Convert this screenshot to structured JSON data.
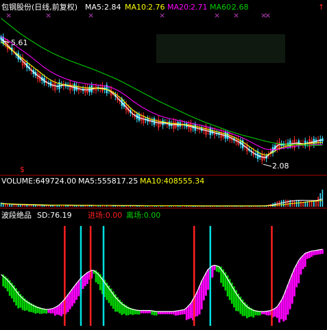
{
  "colors": {
    "bg": "#000000",
    "white": "#FFFFFF",
    "yellow": "#FFFF00",
    "magenta": "#FF00FF",
    "green": "#00D000",
    "red": "#FF2020",
    "cyan": "#00E0E0",
    "candle_up": "#FF3030",
    "candle_down": "#40E0FF",
    "separator": "#B00000",
    "cross": "#C040C0",
    "watermark": "#1A2A1A"
  },
  "price_panel": {
    "title": "包钢股份(日线,前复权)",
    "ma5_label": "MA5:",
    "ma5_value": "2.84",
    "ma10_label": "MA10:",
    "ma10_value": "2.76",
    "ma20_label": "MA20:",
    "ma20_value": "2.71",
    "ma60_label": "MA60:",
    "ma60_value": "2.68",
    "high_marker": "5.61",
    "low_marker": "2.08",
    "currency_icon": "$"
  },
  "volume_panel": {
    "label": "VOLUME:649724.00",
    "ma5_label": "MA5:555817.25",
    "ma10_label": "MA10:408555.34"
  },
  "indicator_panel": {
    "name": "波段绝品",
    "sd_label": "SD:76.19",
    "entry_label": "进场:0.00",
    "exit_label": "离场:0.00"
  },
  "chart_data": [
    {
      "type": "line",
      "panel": "price",
      "ylim": [
        1.9,
        6.6
      ],
      "x_count": 150,
      "high_marker_value": 5.61,
      "low_marker_value": 2.08,
      "series": [
        {
          "name": "MA5",
          "color": "#FFFFFF",
          "values": [
            5.9,
            5.7,
            5.5,
            5.3,
            5.1,
            4.9,
            4.75,
            4.6,
            4.5,
            4.45,
            4.5,
            4.45,
            4.4,
            4.35,
            4.35,
            4.4,
            4.4,
            4.35,
            4.2,
            4.0,
            3.8,
            3.6,
            3.5,
            3.45,
            3.4,
            3.35,
            3.35,
            3.3,
            3.3,
            3.3,
            3.25,
            3.2,
            3.15,
            3.1,
            3.05,
            3.0,
            2.95,
            2.85,
            2.75,
            2.6,
            2.45,
            2.35,
            2.3,
            2.5,
            2.7,
            2.7,
            2.72,
            2.75,
            2.72,
            2.76,
            2.8,
            2.84
          ]
        },
        {
          "name": "MA10",
          "color": "#FFFF00",
          "values": [
            5.8,
            5.65,
            5.5,
            5.35,
            5.2,
            5.05,
            4.9,
            4.75,
            4.62,
            4.55,
            4.5,
            4.48,
            4.45,
            4.42,
            4.4,
            4.4,
            4.38,
            4.35,
            4.25,
            4.1,
            3.9,
            3.72,
            3.6,
            3.52,
            3.45,
            3.4,
            3.37,
            3.34,
            3.32,
            3.3,
            3.28,
            3.24,
            3.2,
            3.15,
            3.1,
            3.05,
            3.0,
            2.92,
            2.82,
            2.7,
            2.56,
            2.44,
            2.38,
            2.45,
            2.58,
            2.64,
            2.68,
            2.71,
            2.72,
            2.74,
            2.75,
            2.76
          ]
        },
        {
          "name": "MA20",
          "color": "#FF00FF",
          "values": [
            5.95,
            5.85,
            5.72,
            5.58,
            5.45,
            5.3,
            5.15,
            5.0,
            4.88,
            4.78,
            4.7,
            4.63,
            4.58,
            4.55,
            4.52,
            4.5,
            4.48,
            4.45,
            4.38,
            4.28,
            4.15,
            4.0,
            3.87,
            3.76,
            3.66,
            3.58,
            3.52,
            3.47,
            3.43,
            3.39,
            3.35,
            3.31,
            3.27,
            3.22,
            3.17,
            3.12,
            3.07,
            3.0,
            2.93,
            2.84,
            2.74,
            2.64,
            2.56,
            2.54,
            2.56,
            2.6,
            2.63,
            2.66,
            2.68,
            2.69,
            2.7,
            2.71
          ]
        },
        {
          "name": "MA60",
          "color": "#00D000",
          "values": [
            6.5,
            6.35,
            6.2,
            6.05,
            5.92,
            5.8,
            5.68,
            5.57,
            5.47,
            5.38,
            5.3,
            5.22,
            5.15,
            5.08,
            5.01,
            4.94,
            4.86,
            4.78,
            4.7,
            4.61,
            4.51,
            4.41,
            4.31,
            4.21,
            4.11,
            4.01,
            3.92,
            3.83,
            3.74,
            3.65,
            3.56,
            3.48,
            3.4,
            3.33,
            3.26,
            3.19,
            3.12,
            3.06,
            3.0,
            2.95,
            2.9,
            2.85,
            2.8,
            2.76,
            2.73,
            2.71,
            2.7,
            2.69,
            2.685,
            2.68,
            2.68,
            2.68
          ]
        }
      ]
    },
    {
      "type": "bar",
      "panel": "volume",
      "ylim": [
        0,
        1.2
      ],
      "x_count": 150,
      "series": [
        {
          "name": "VOLUME",
          "values": [
            0.25,
            0.18,
            0.12,
            0.1,
            0.14,
            0.1,
            0.08,
            0.08,
            0.1,
            0.12,
            0.1,
            0.08,
            0.07,
            0.06,
            0.08,
            0.1,
            0.09,
            0.07,
            0.06,
            0.06,
            0.07,
            0.08,
            0.06,
            0.05,
            0.06,
            0.07,
            0.06,
            0.05,
            0.05,
            0.06,
            0.05,
            0.05,
            0.06,
            0.05,
            0.05,
            0.06,
            0.06,
            0.05,
            0.05,
            0.06,
            0.05,
            0.05,
            0.08,
            0.18,
            0.35,
            0.42,
            0.4,
            0.38,
            0.3,
            0.35,
            0.4,
            1.0
          ]
        },
        {
          "name": "MA5",
          "values": [
            0.2,
            0.17,
            0.14,
            0.13,
            0.12,
            0.11,
            0.1,
            0.09,
            0.09,
            0.1,
            0.1,
            0.09,
            0.08,
            0.08,
            0.08,
            0.08,
            0.08,
            0.08,
            0.07,
            0.07,
            0.07,
            0.07,
            0.06,
            0.06,
            0.06,
            0.06,
            0.06,
            0.06,
            0.06,
            0.06,
            0.05,
            0.05,
            0.05,
            0.05,
            0.05,
            0.05,
            0.05,
            0.05,
            0.05,
            0.05,
            0.05,
            0.05,
            0.06,
            0.1,
            0.18,
            0.26,
            0.33,
            0.38,
            0.38,
            0.37,
            0.36,
            0.46
          ]
        },
        {
          "name": "MA10",
          "values": [
            0.18,
            0.17,
            0.16,
            0.15,
            0.14,
            0.13,
            0.12,
            0.11,
            0.1,
            0.1,
            0.1,
            0.1,
            0.09,
            0.09,
            0.09,
            0.08,
            0.08,
            0.08,
            0.08,
            0.07,
            0.07,
            0.07,
            0.07,
            0.06,
            0.06,
            0.06,
            0.06,
            0.06,
            0.06,
            0.06,
            0.06,
            0.06,
            0.05,
            0.05,
            0.05,
            0.05,
            0.05,
            0.05,
            0.05,
            0.05,
            0.05,
            0.05,
            0.05,
            0.07,
            0.1,
            0.14,
            0.18,
            0.22,
            0.26,
            0.3,
            0.33,
            0.37
          ]
        }
      ]
    },
    {
      "type": "bar",
      "panel": "indicator",
      "ylim": [
        0,
        100
      ],
      "sd_value": 76.19,
      "entry_value": 0.0,
      "exit_value": 0.0,
      "sd_values": [
        50,
        45,
        38,
        30,
        24,
        20,
        17,
        15,
        14,
        15,
        18,
        24,
        32,
        40,
        47,
        52,
        55,
        50,
        42,
        34,
        26,
        20,
        16,
        14,
        13,
        13,
        13,
        12,
        12,
        12,
        12,
        13,
        14,
        20,
        30,
        44,
        55,
        60,
        58,
        50,
        40,
        30,
        22,
        16,
        13,
        12,
        12,
        13,
        16,
        25,
        40,
        55,
        66,
        72,
        74,
        75,
        76
      ],
      "buy_signals_x_fraction": [
        0.2,
        0.28,
        0.6,
        0.84
      ],
      "sell_signals_x_fraction": [
        0.25,
        0.32,
        0.65
      ]
    }
  ]
}
